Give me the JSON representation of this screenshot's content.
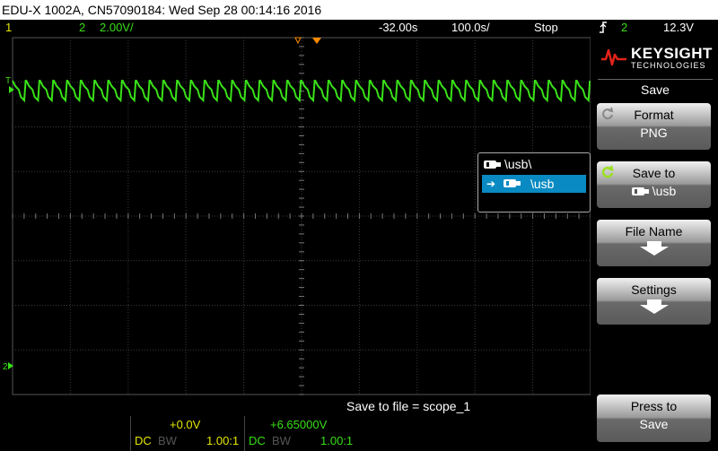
{
  "title": "EDU-X 1002A, CN57090184: Wed Sep 28 00:14:16 2016",
  "status": {
    "ch1_num": "1",
    "ch2_num": "2",
    "ch2_scale": "2.00V/",
    "delay": "-32.00s",
    "timebase": "100.0s/",
    "run_state": "Stop",
    "trigger_ch": "2",
    "trigger_level": "12.3V"
  },
  "dir_browser": {
    "header": "\\usb\\",
    "selected": "\\usb"
  },
  "save_to_file": "Save to file =  scope_1",
  "channels": {
    "ch1_offset": "+0.0V",
    "ch1_coupling": "DC",
    "ch1_bw": "BW",
    "ch1_probe": "1.00:1",
    "ch2_offset": "+6.65000V",
    "ch2_coupling": "DC",
    "ch2_bw": "BW",
    "ch2_probe": "1.00:1"
  },
  "brand": {
    "name": "KEYSIGHT",
    "sub": "TECHNOLOGIES"
  },
  "softmenu": {
    "title": "Save",
    "format_label": "Format",
    "format_value": "PNG",
    "save_to_label": "Save to",
    "save_to_value": "\\usb",
    "file_name_label": "File Name",
    "settings_label": "Settings",
    "press_to_save_1": "Press to",
    "press_to_save_2": "Save"
  },
  "colors": {
    "ch1": "#e6e600",
    "ch2": "#39e018",
    "trigger_marker": "#ff8c00",
    "selection": "#0a8ac2"
  },
  "icons": [
    "usb-drive-icon",
    "arrow-right-icon",
    "cycle-icon",
    "down-arrow-icon",
    "keysight-logo-icon",
    "trigger-edge-icon"
  ]
}
